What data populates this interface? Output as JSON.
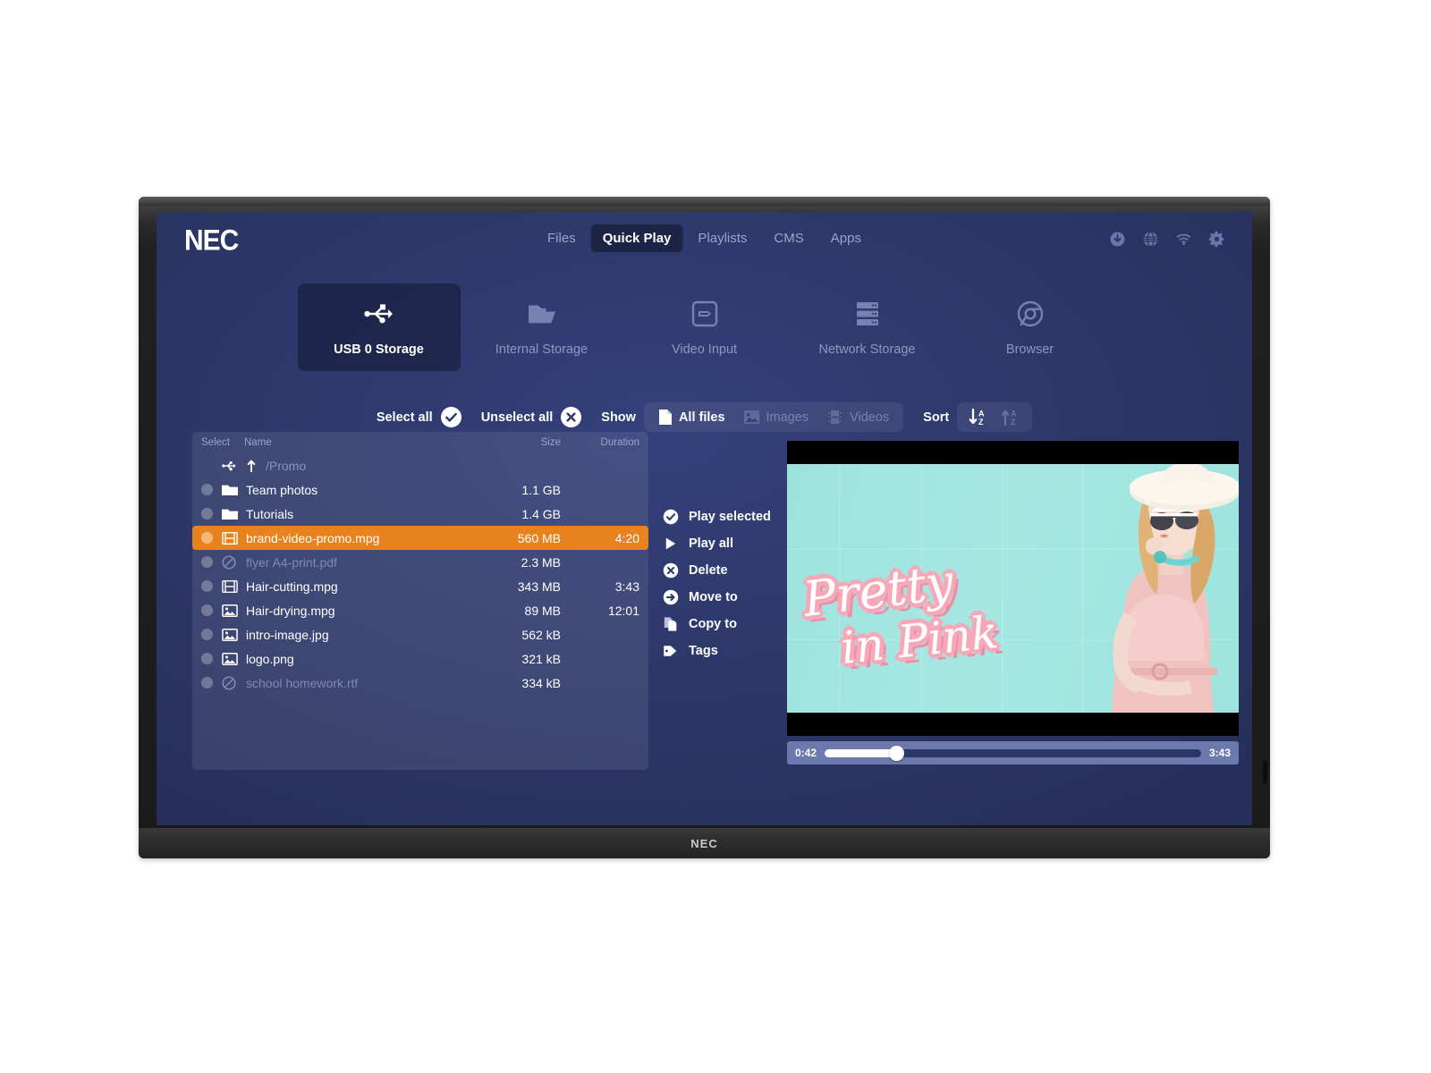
{
  "brand": {
    "logo": "NEC",
    "bezel_logo": "NEC"
  },
  "header": {
    "nav": [
      {
        "label": "Files",
        "active": false
      },
      {
        "label": "Quick Play",
        "active": true
      },
      {
        "label": "Playlists",
        "active": false
      },
      {
        "label": "CMS",
        "active": false
      },
      {
        "label": "Apps",
        "active": false
      }
    ],
    "icons": [
      {
        "name": "download-icon"
      },
      {
        "name": "globe-icon"
      },
      {
        "name": "wifi-icon"
      },
      {
        "name": "gear-icon"
      }
    ]
  },
  "storage_tabs": [
    {
      "label": "USB 0 Storage",
      "icon": "usb-icon",
      "active": true
    },
    {
      "label": "Internal Storage",
      "icon": "folder-icon",
      "active": false
    },
    {
      "label": "Video Input",
      "icon": "hdmi-input-icon",
      "active": false
    },
    {
      "label": "Network Storage",
      "icon": "server-icon",
      "active": false
    },
    {
      "label": "Browser",
      "icon": "chrome-icon",
      "active": false
    }
  ],
  "toolbar": {
    "select_all": "Select all",
    "unselect_all": "Unselect all",
    "show_label": "Show",
    "filters": [
      {
        "label": "All files",
        "icon": "document-icon",
        "active": true
      },
      {
        "label": "Images",
        "icon": "image-icon",
        "active": false
      },
      {
        "label": "Videos",
        "icon": "film-icon",
        "active": false
      }
    ],
    "sort_label": "Sort",
    "sort_buttons": [
      {
        "name": "sort-descending-icon",
        "active": true
      },
      {
        "name": "sort-ascending-icon",
        "active": false
      }
    ]
  },
  "file_list": {
    "columns": {
      "select": "Select",
      "name": "Name",
      "size": "Size",
      "duration": "Duration"
    },
    "current_path": "/Promo",
    "rows": [
      {
        "name": "Team photos",
        "size": "1.1 GB",
        "duration": "",
        "icon": "folder-icon",
        "state": "normal"
      },
      {
        "name": "Tutorials",
        "size": "1.4 GB",
        "duration": "",
        "icon": "folder-icon",
        "state": "normal"
      },
      {
        "name": "brand-video-promo.mpg",
        "size": "560 MB",
        "duration": "4:20",
        "icon": "film-icon",
        "state": "selected"
      },
      {
        "name": "flyer A4-print.pdf",
        "size": "2.3 MB",
        "duration": "",
        "icon": "blocked-icon",
        "state": "disabled"
      },
      {
        "name": "Hair-cutting.mpg",
        "size": "343 MB",
        "duration": "3:43",
        "icon": "film-icon",
        "state": "normal"
      },
      {
        "name": "Hair-drying.mpg",
        "size": "89 MB",
        "duration": "12:01",
        "icon": "image-icon",
        "state": "normal"
      },
      {
        "name": "intro-image.jpg",
        "size": "562 kB",
        "duration": "",
        "icon": "image-icon",
        "state": "normal"
      },
      {
        "name": "logo.png",
        "size": "321 kB",
        "duration": "",
        "icon": "image-icon",
        "state": "normal"
      },
      {
        "name": "school homework.rtf",
        "size": "334 kB",
        "duration": "",
        "icon": "blocked-icon",
        "state": "disabled"
      }
    ]
  },
  "actions": [
    {
      "label": "Play selected",
      "icon": "check-circle-icon"
    },
    {
      "label": "Play all",
      "icon": "play-icon"
    },
    {
      "label": "Delete",
      "icon": "close-circle-icon"
    },
    {
      "label": "Move to",
      "icon": "arrow-circle-icon"
    },
    {
      "label": "Copy to",
      "icon": "copy-icon"
    },
    {
      "label": "Tags",
      "icon": "tag-icon"
    }
  ],
  "player": {
    "current_time": "0:42",
    "total_time": "3:43",
    "progress_percent": 19,
    "video_title_line1": "Pretty",
    "video_title_line2": "in Pink"
  },
  "colors": {
    "accent_orange": "#e8821e",
    "screen_blue": "#2e3a6d",
    "nav_active_bg": "#1d2547",
    "text_muted": "#8d98c0"
  }
}
